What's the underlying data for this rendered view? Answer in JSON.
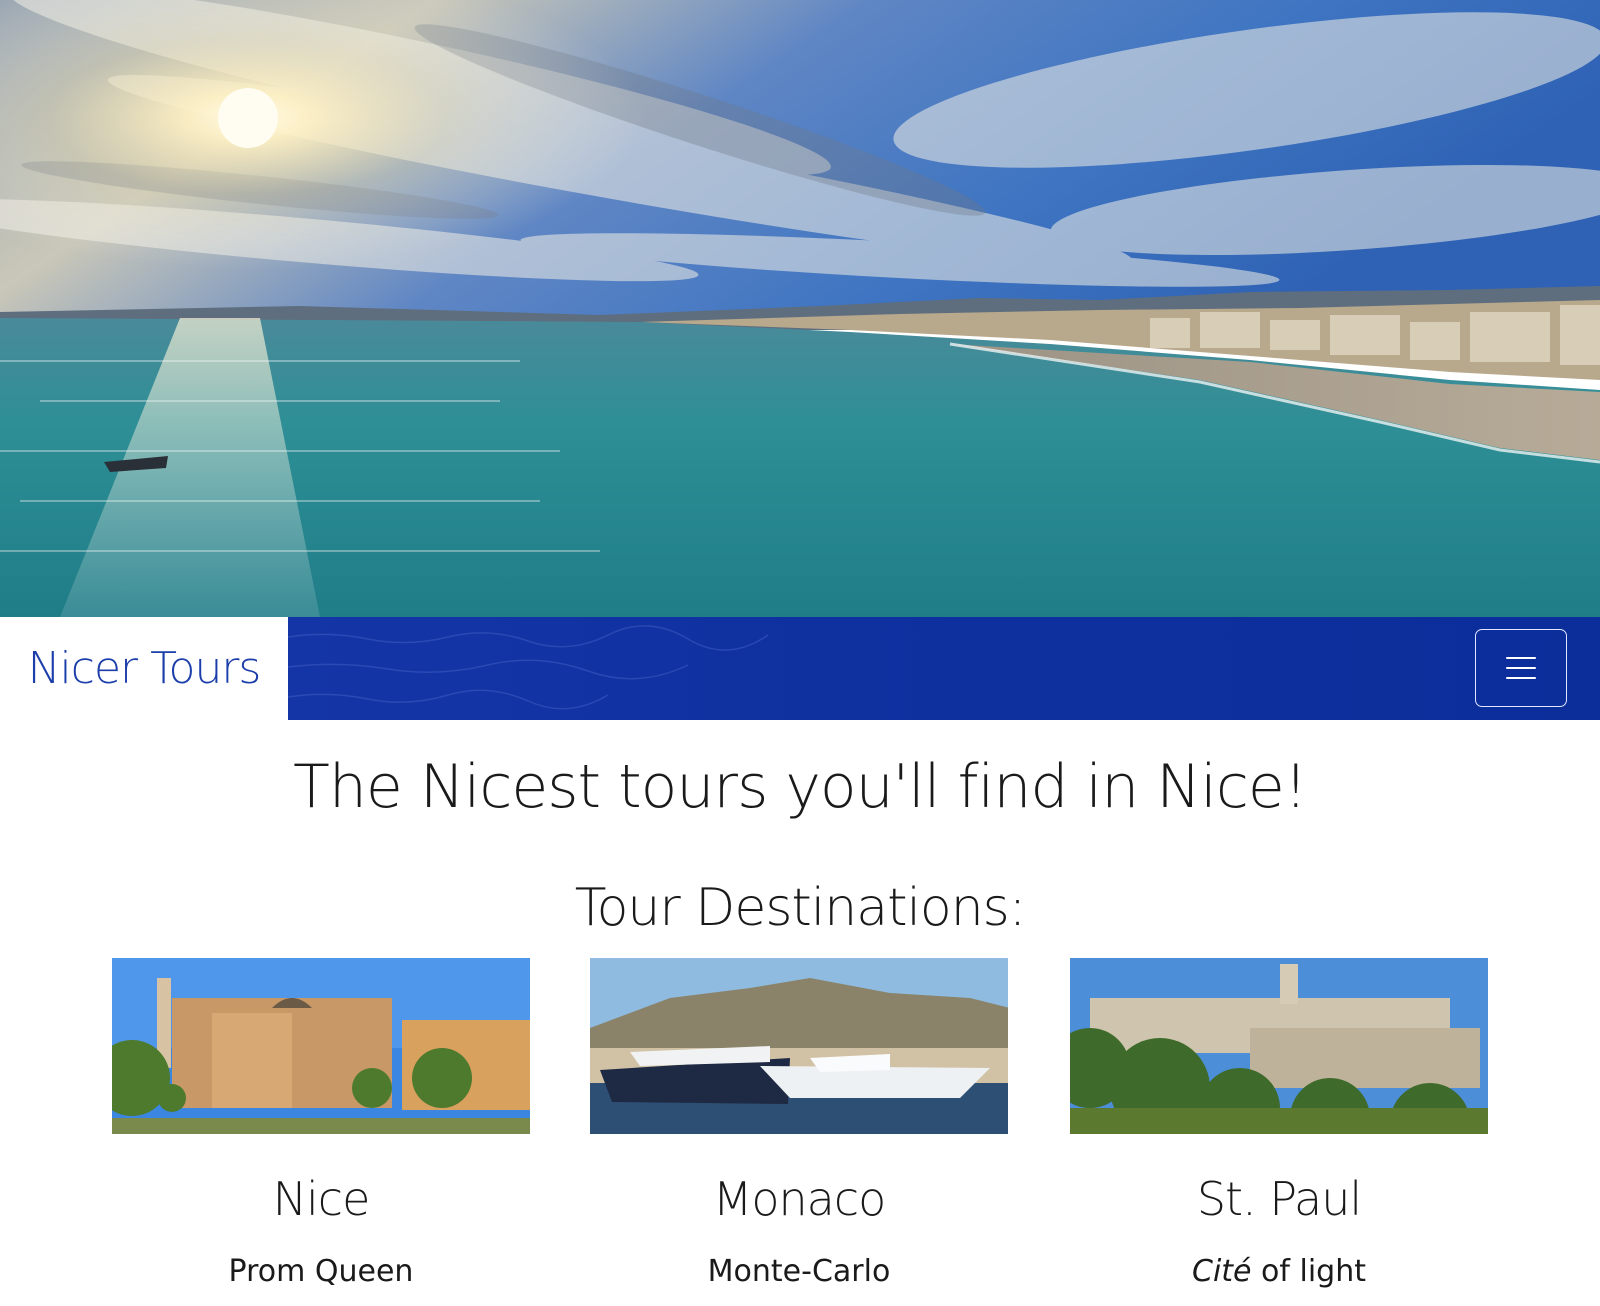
{
  "brand": {
    "name": "Nicer Tours"
  },
  "nav": {
    "toggler_icon": "hamburger-menu-icon"
  },
  "hero": {
    "image": "Nice bay panorama with sun over the Mediterranean"
  },
  "tagline": "The Nicest tours you'll find in Nice!",
  "section_title": "Tour Destinations:",
  "destinations": [
    {
      "title": "Nice",
      "subtitle": "Prom Queen"
    },
    {
      "title": "Monaco",
      "subtitle": "Monte-Carlo"
    },
    {
      "title": "St. Paul",
      "subtitle_italic": "Cité",
      "subtitle_rest": " of light"
    }
  ],
  "colors": {
    "brand_blue": "#1b3eaa",
    "nav_blue": "#0f31a0",
    "sea_teal": "#2e8f96",
    "sky_blue": "#3f75c2"
  }
}
